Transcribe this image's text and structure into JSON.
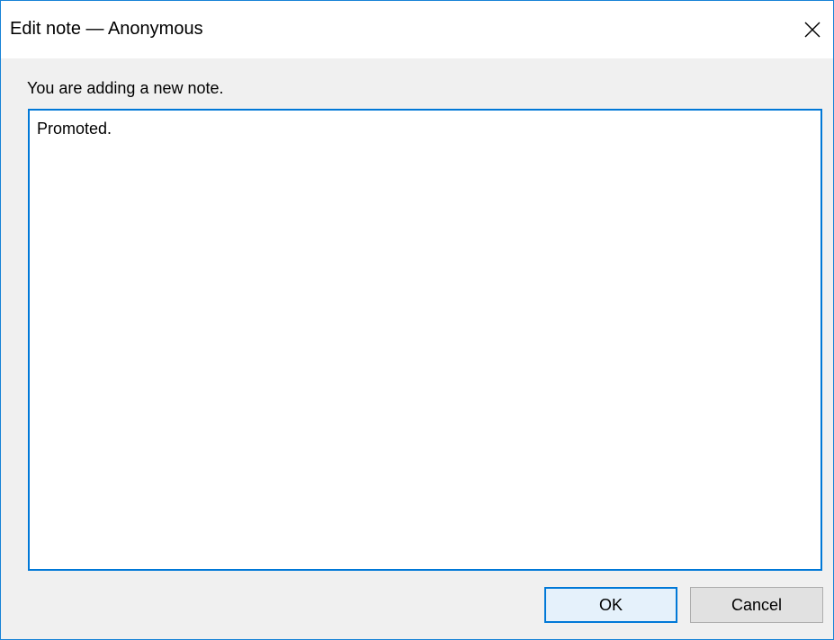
{
  "window": {
    "title": "Edit note — Anonymous",
    "close_icon": "close-icon"
  },
  "dialog": {
    "instruction": "You are adding a new note.",
    "note_text": "Promoted."
  },
  "buttons": {
    "ok_label": "OK",
    "cancel_label": "Cancel"
  },
  "colors": {
    "accent": "#0078d7",
    "window_border": "#1883d7",
    "dialog_background": "#f0f0f0",
    "ok_background": "#e5f1fb",
    "cancel_background": "#e1e1e1"
  }
}
